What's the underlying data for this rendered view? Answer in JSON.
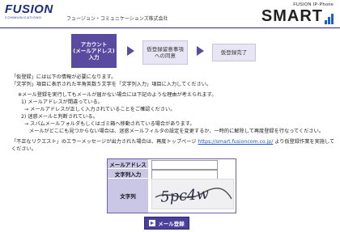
{
  "header": {
    "logo_main": "FUSION",
    "logo_sub": "COMMUNICATIONS",
    "company": "フュージョン・コミュニケーションズ株式会社",
    "brand_small": "FUSION IP-Phone",
    "brand_large": "SMART"
  },
  "steps": {
    "step1": [
      "アカウント",
      "(メールアドレス)",
      "入力"
    ],
    "step2": [
      "仮登録留意事項",
      "への同意"
    ],
    "step3": "仮登録完了"
  },
  "intro": [
    "「仮登録」には以下の情報が必要になります。",
    "「文字列」項目に表示された半角英数５文字を「文字列入力」項目に入力してください。"
  ],
  "notes": [
    "※メール登録を実行してもメールが届かない場合には下記のような理由が考えられます。",
    "1) メールアドレスが間違っている。",
    "→ メールアドレスが正しく入力されていることをご確認ください。",
    "2) 迷惑メールと判断されている。",
    "→ スパムメールフォルダもしくはゴミ箱へ移動されている場合があります。",
    "メールがどこにも見つからない場合は、迷惑メールフィルタの設定を変更するか、一時的に解除して再度登録を行なってください。"
  ],
  "error_note": {
    "before": "「不正なリクエスト」のエラーメッセージが出力された場合は、再度トップページ ",
    "link": "https://smart.fusioncom.co.jp/",
    "after": " より仮登録作業を実施して",
    "line2": "ください。"
  },
  "form": {
    "email_label": "メールアドレス",
    "text_input_label": "文字列入力",
    "captcha_label": "文字列",
    "email_value": "",
    "text_input_value": "",
    "captcha_text": "5pc4w"
  },
  "submit_label": "メール登録",
  "colors": {
    "accent": "#5a4aa0",
    "header_rule": "#2a2a8a",
    "label_bg": "#c9c6e6",
    "link": "#2255cc"
  }
}
